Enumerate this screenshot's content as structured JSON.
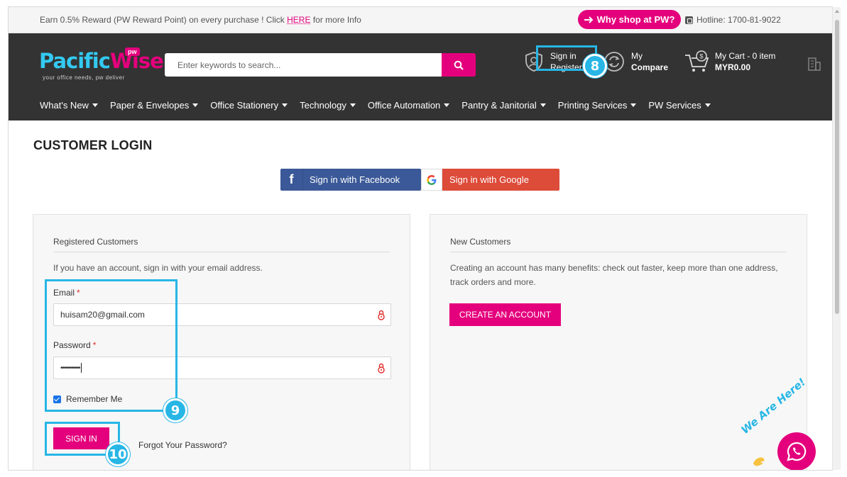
{
  "topbar": {
    "promo_prefix": "Earn 0.5% Reward (PW Reward Point) on every purchase ! Click ",
    "promo_link": "HERE",
    "promo_suffix": " for more Info",
    "why_shop_label": "Why shop at PW?",
    "hotline": "Hotline: 1700-81-9022"
  },
  "header": {
    "logo_part1": "Pacific",
    "logo_part2": "Wise",
    "logo_badge": "pw",
    "logo_tagline": "your office needs, pw deliver",
    "search_placeholder": "Enter keywords to search...",
    "signin_label": "Sign in",
    "register_label": "Register",
    "compare_line1": "My",
    "compare_line2": "Compare",
    "cart_line1": "My Cart - 0 item",
    "cart_total": "MYR0.00"
  },
  "nav": {
    "items": [
      "What's New",
      "Paper & Envelopes",
      "Office Stationery",
      "Technology",
      "Office Automation",
      "Pantry & Janitorial",
      "Printing Services",
      "PW Services"
    ]
  },
  "page": {
    "title": "CUSTOMER LOGIN",
    "facebook_label": "Sign in with Facebook",
    "google_label": "Sign in with Google"
  },
  "registered": {
    "title": "Registered Customers",
    "description": "If you have an account, sign in with your email address.",
    "email_label": "Email",
    "email_value": "huisam20@gmail.com",
    "password_label": "Password",
    "password_value": "•••••••••••",
    "required_mark": "*",
    "remember_label": "Remember Me",
    "remember_checked": true,
    "signin_button": "SIGN IN",
    "forgot_link": "Forgot Your Password?"
  },
  "new_customers": {
    "title": "New Customers",
    "description": "Creating an account has many benefits: check out faster, keep more than one address, track orders and more.",
    "create_button": "CREATE AN ACCOUNT"
  },
  "annotations": {
    "step_8": "8",
    "step_9": "9",
    "step_10": "10"
  },
  "chat": {
    "label": "We Are Here!"
  },
  "colors": {
    "brand_pink": "#e4007c",
    "brand_cyan": "#33c9f1",
    "header_bg": "#333333",
    "annotation": "#27b6e6",
    "facebook": "#3b5998",
    "google": "#dd4b39"
  }
}
